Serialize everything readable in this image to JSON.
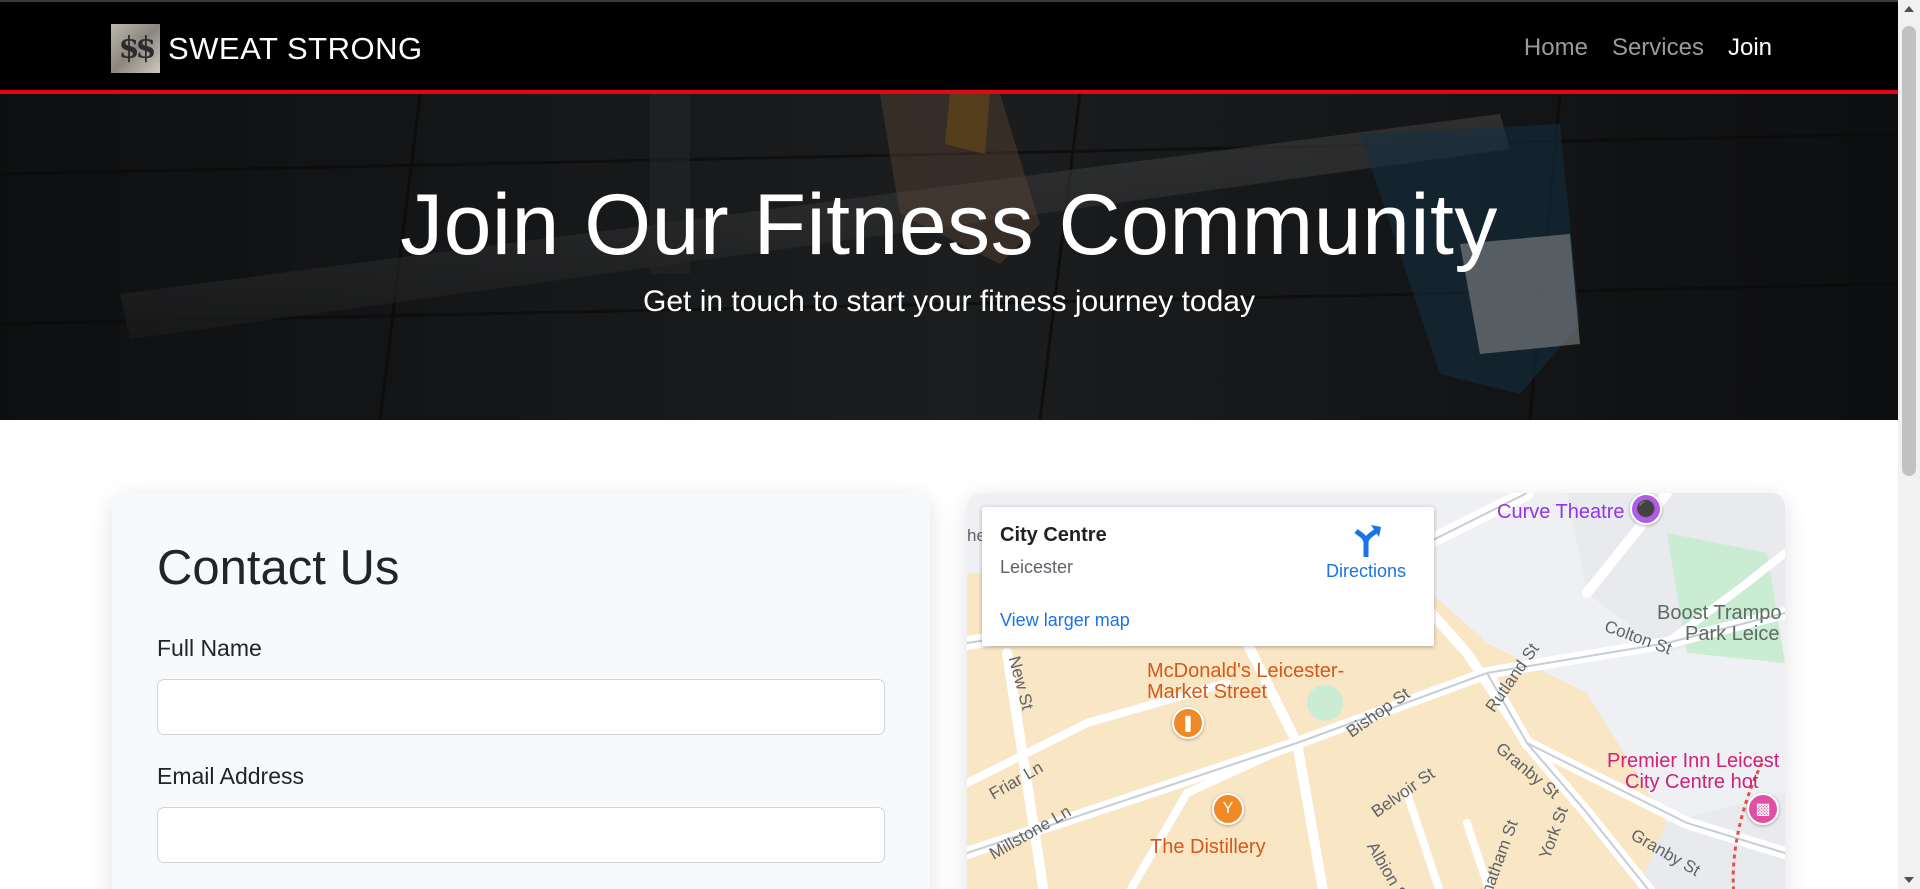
{
  "navbar": {
    "brand_logo_text": "$$",
    "brand_name": "SWEAT STRONG",
    "links": [
      {
        "label": "Home"
      },
      {
        "label": "Services"
      },
      {
        "label": "Join"
      }
    ],
    "active_color": "#ffffff",
    "inactive_color": "#9a9a9a",
    "accent_color": "#e30613"
  },
  "hero": {
    "title": "Join Our Fitness Community",
    "subtitle": "Get in touch to start your fitness journey today"
  },
  "contact": {
    "title": "Contact Us",
    "fields": [
      {
        "label": "Full Name",
        "value": "",
        "placeholder": ""
      },
      {
        "label": "Email Address",
        "value": "",
        "placeholder": ""
      }
    ]
  },
  "map": {
    "info": {
      "title": "City Centre",
      "subtitle": "Leicester",
      "directions_label": "Directions",
      "view_larger_label": "View larger map"
    },
    "labels": {
      "curve_theatre": "Curve Theatre",
      "boost_line1": "Boost Trampo",
      "boost_line2": "Park Leice",
      "mcdonalds_line1": "McDonald's Leicester-",
      "mcdonalds_line2": "Market Street",
      "distillery": "The Distillery",
      "premier_line1": "Premier Inn Leicest",
      "premier_line2": "City Centre hot",
      "colton_st": "Colton St",
      "rutland_st": "Rutland St",
      "bishop_st": "Bishop St",
      "new_st": "New St",
      "friar_ln": "Friar Ln",
      "millstone_ln": "Millstone Ln",
      "belvoir_st": "Belvoir St",
      "granby_st": "Granby St",
      "granby_st_2": "Granby St",
      "chatham_st": "Chatham St",
      "york_st": "York St",
      "albion_st": "Albion St",
      "edge_he": "he"
    },
    "colors": {
      "road": "#ffffff",
      "block": "#f8e6c5",
      "park": "#c9ecd3",
      "link": "#1a73e8"
    }
  }
}
